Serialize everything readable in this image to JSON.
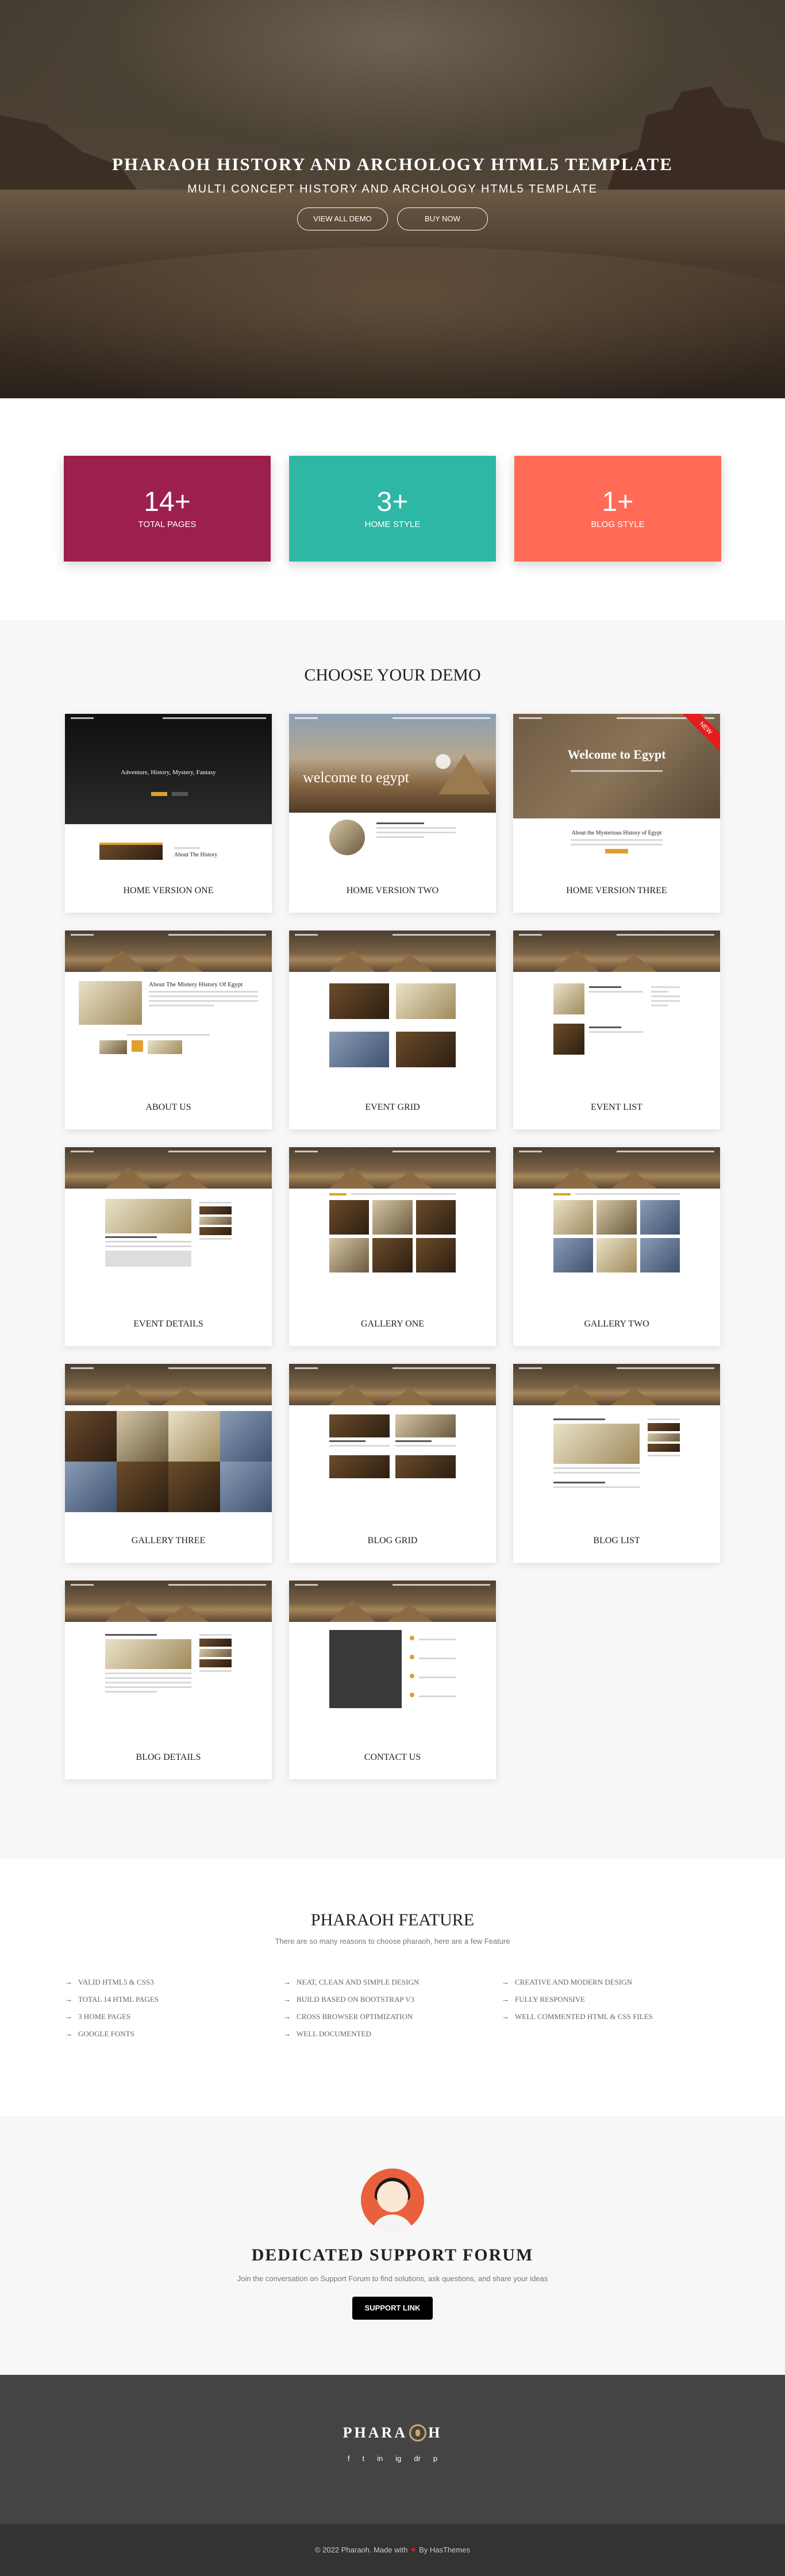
{
  "hero": {
    "title": "PHARAOH HISTORY AND ARCHOLOGY HTML5 TEMPLATE",
    "subtitle": "MULTI CONCEPT HISTORY AND ARCHOLOGY HTML5 TEMPLATE",
    "btn_demo": "VIEW ALL DEMO",
    "btn_buy": "BUY NOW"
  },
  "stats": [
    {
      "num": "14+",
      "label": "TOTAL PAGES",
      "color": "#9c1f4d"
    },
    {
      "num": "3+",
      "label": "HOME STYLE",
      "color": "#2db7a4"
    },
    {
      "num": "1+",
      "label": "BLOG STYLE",
      "color": "#ff6b57"
    }
  ],
  "demos": {
    "title": "CHOOSE YOUR DEMO",
    "ribbon": "NEW",
    "thumb_text": {
      "home1": "Adventure, History, Mystery, Fantasy",
      "home1_sub": "About The History",
      "home2": "welcome to egypt",
      "home3": "Welcome to Egypt",
      "home3_sub": "About the Mysterious History of Egypt",
      "about": "About The Mistery History Of Egypt"
    },
    "items": [
      "HOME VERSION ONE",
      "HOME VERSION TWO",
      "HOME VERSION THREE",
      "ABOUT US",
      "EVENT GRID",
      "EVENT LIST",
      "EVENT DETAILS",
      "GALLERY ONE",
      "GALLERY TWO",
      "GALLERY THREE",
      "BLOG GRID",
      "BLOG LIST",
      "BLOG DETAILS",
      "CONTACT US"
    ]
  },
  "feature": {
    "title": "PHARAOH FEATURE",
    "subtitle": "There are so many reasons to choose pharaoh, here are a few Feature",
    "col1": [
      "VALID HTML5 & CSS3",
      "TOTAL 14 HTML PAGES",
      "3 HOME PAGES",
      "GOOGLE FONTS"
    ],
    "col2": [
      "NEAT, CLEAN AND SIMPLE DESIGN",
      "BUILD BASED ON BOOTSTRAP V3",
      "CROSS BROWSER OPTIMIZATION",
      "WELL DOCUMENTED"
    ],
    "col3": [
      "CREATIVE AND MODERN DESIGN",
      "FULLY RESPONSIVE",
      "WELL COMMENTED HTML & CSS FILES"
    ]
  },
  "support": {
    "title": "DEDICATED SUPPORT FORUM",
    "text": "Join the conversation on Support Forum to find solutions, ask questions, and share your ideas",
    "button": "SUPPORT LINK"
  },
  "footer": {
    "logo_left": "PHARA",
    "logo_right": "H",
    "social": [
      "f",
      "t",
      "in",
      "ig",
      "dr",
      "p"
    ],
    "copy_pre": "© 2022 Pharaoh. Made with",
    "copy_post": "By HasThemes"
  }
}
